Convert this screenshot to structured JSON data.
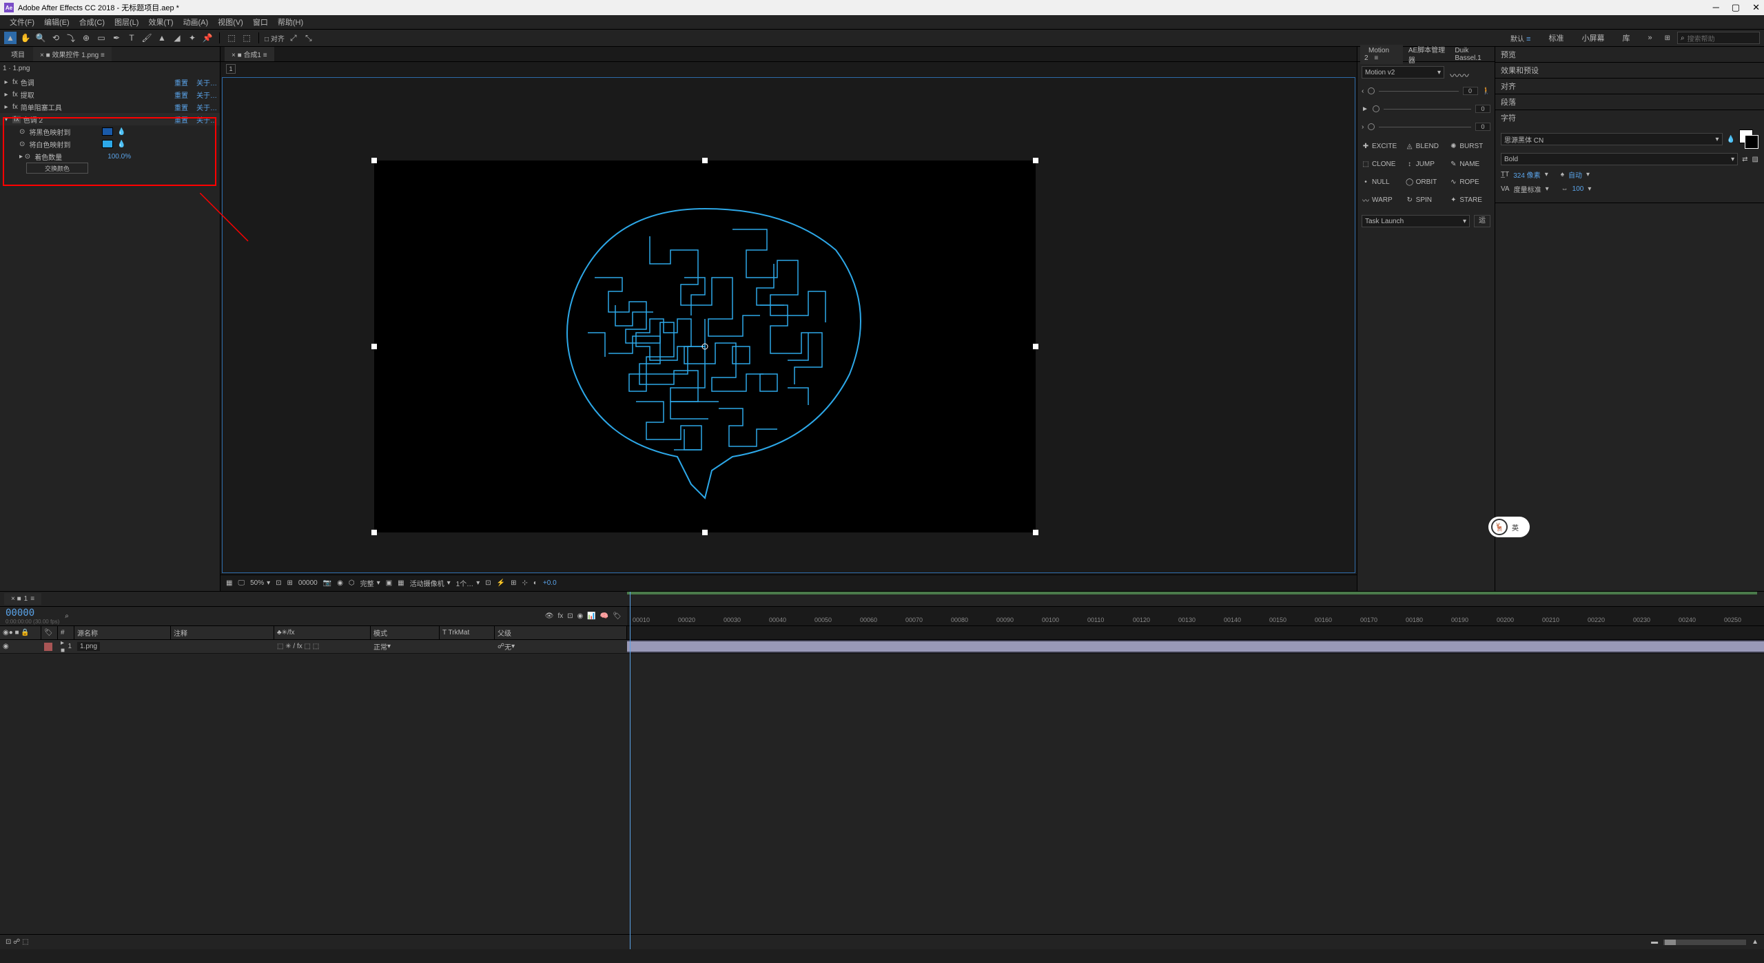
{
  "titlebar": {
    "app": "Adobe After Effects CC 2018 - 无标题项目.aep *"
  },
  "menu": [
    "文件(F)",
    "编辑(E)",
    "合成(C)",
    "图层(L)",
    "效果(T)",
    "动画(A)",
    "视图(V)",
    "窗口",
    "帮助(H)"
  ],
  "toolbar": {
    "snap": "□ 对齐"
  },
  "workspace": {
    "items": [
      "默认",
      "标准",
      "小屏幕",
      "库"
    ],
    "active": "默认",
    "search_placeholder": "搜索帮助"
  },
  "left_panel": {
    "tabs": [
      "项目",
      "效果控件 1.png"
    ],
    "layer": "1 · 1.png",
    "fx": [
      {
        "name": "色调",
        "reset": "重置",
        "about": "关于…"
      },
      {
        "name": "提取",
        "reset": "重置",
        "about": "关于…"
      },
      {
        "name": "简单阻塞工具",
        "reset": "重置",
        "about": "关于…"
      },
      {
        "name": "色调 2",
        "reset": "重置",
        "about": "关于…",
        "selected": true
      }
    ],
    "props": {
      "black": "将黑色映射到",
      "white": "将白色映射到",
      "amount_label": "着色数量",
      "amount_val": "100.0%",
      "swap": "交换颜色"
    }
  },
  "viewer": {
    "tab": "合成1",
    "sub": "1",
    "footer": {
      "zoom": "50%",
      "time": "00000",
      "quality": "完整",
      "camera": "活动摄像机",
      "view": "1个…",
      "exposure": "+0.0"
    }
  },
  "motion": {
    "tabs": [
      "Motion 2",
      "AE脚本管理器",
      "Duik Bassel.1"
    ],
    "select": "Motion v2",
    "sliders": [
      0,
      0,
      0
    ],
    "buttons": [
      {
        "ic": "✚",
        "t": "EXCITE"
      },
      {
        "ic": "◬",
        "t": "BLEND"
      },
      {
        "ic": "✺",
        "t": "BURST"
      },
      {
        "ic": "⬚",
        "t": "CLONE"
      },
      {
        "ic": "↕",
        "t": "JUMP"
      },
      {
        "ic": "✎",
        "t": "NAME"
      },
      {
        "ic": "•",
        "t": "NULL"
      },
      {
        "ic": "◯",
        "t": "ORBIT"
      },
      {
        "ic": "∿",
        "t": "ROPE"
      },
      {
        "ic": "〰",
        "t": "WARP"
      },
      {
        "ic": "↻",
        "t": "SPIN"
      },
      {
        "ic": "✦",
        "t": "STARE"
      }
    ],
    "task": "Task Launch",
    "go": "运"
  },
  "side": {
    "sections": [
      "预览",
      "效果和预设",
      "对齐",
      "段落",
      "字符"
    ],
    "char": {
      "font": "思源黑体 CN",
      "weight": "Bold",
      "size": "324 像素",
      "leading": "自动",
      "tracking_label": "度量标准",
      "tracking": "100"
    }
  },
  "timeline": {
    "tab": "1",
    "timecode": "00000",
    "fps_note": "0:00:00:00 (30.00 fps)",
    "columns": {
      "eye": "◉",
      "num": "#",
      "src": "源名称",
      "comment": "注释",
      "switches": "♣✳/fx",
      "mode": "模式",
      "trkmat": "T TrkMat",
      "parent": "父级"
    },
    "row": {
      "num": "1",
      "name": "1.png",
      "mode": "正常",
      "parent": "无"
    },
    "ticks": [
      "00010",
      "00020",
      "00030",
      "00040",
      "00050",
      "00060",
      "00070",
      "00080",
      "00090",
      "00100",
      "00110",
      "00120",
      "00130",
      "00140",
      "00150",
      "00160",
      "00170",
      "00180",
      "00190",
      "00200",
      "00210",
      "00220",
      "00230",
      "00240",
      "00250"
    ]
  }
}
